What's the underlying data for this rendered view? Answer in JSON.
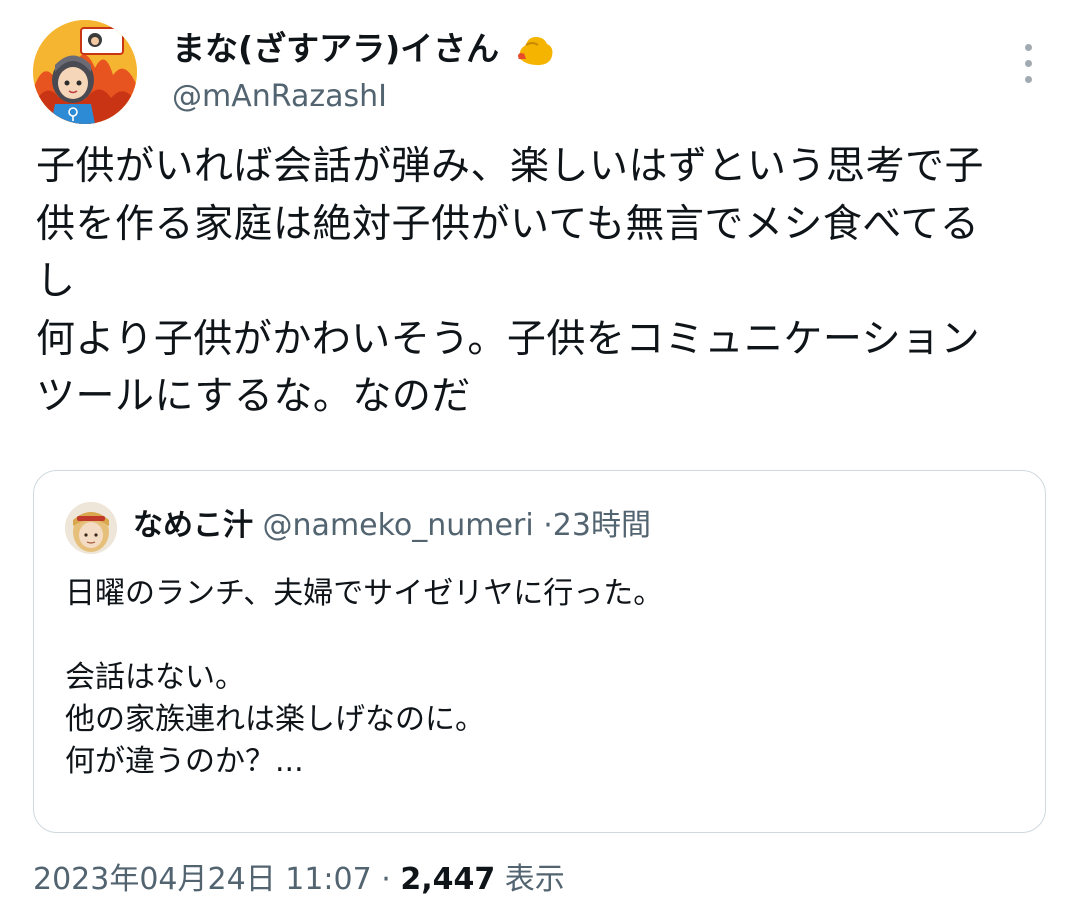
{
  "author": {
    "display_name": "まな(ざすアラ)イさん",
    "handle": "@mAnRazashI"
  },
  "tweet": {
    "lines": [
      "子供がいれば会話が弾み、楽しいはずという思考で子",
      "供を作る家庭は絶対子供がいても無言でメシ食べてる",
      "し",
      "何より子供がかわいそう。子供をコミュニケーション",
      "ツールにするな。なのだ"
    ]
  },
  "quote": {
    "display_name": "なめこ汁",
    "handle": "@nameko_numeri",
    "separator": "·",
    "time": "23時間",
    "lines": [
      "日曜のランチ、夫婦でサイゼリヤに行った。",
      "",
      "会話はない。",
      "他の家族連れは楽しげなのに。",
      "何が違うのか？..."
    ]
  },
  "meta": {
    "timestamp": "2023年04月24日 11:07",
    "separator": "·",
    "views_count": "2,447",
    "views_label": "表示"
  },
  "icons": {
    "more": "more-icon",
    "emoji": "flexed-arm-emoji"
  },
  "colors": {
    "text": "#0f1419",
    "secondary": "#536471",
    "border": "#cfd9de"
  }
}
